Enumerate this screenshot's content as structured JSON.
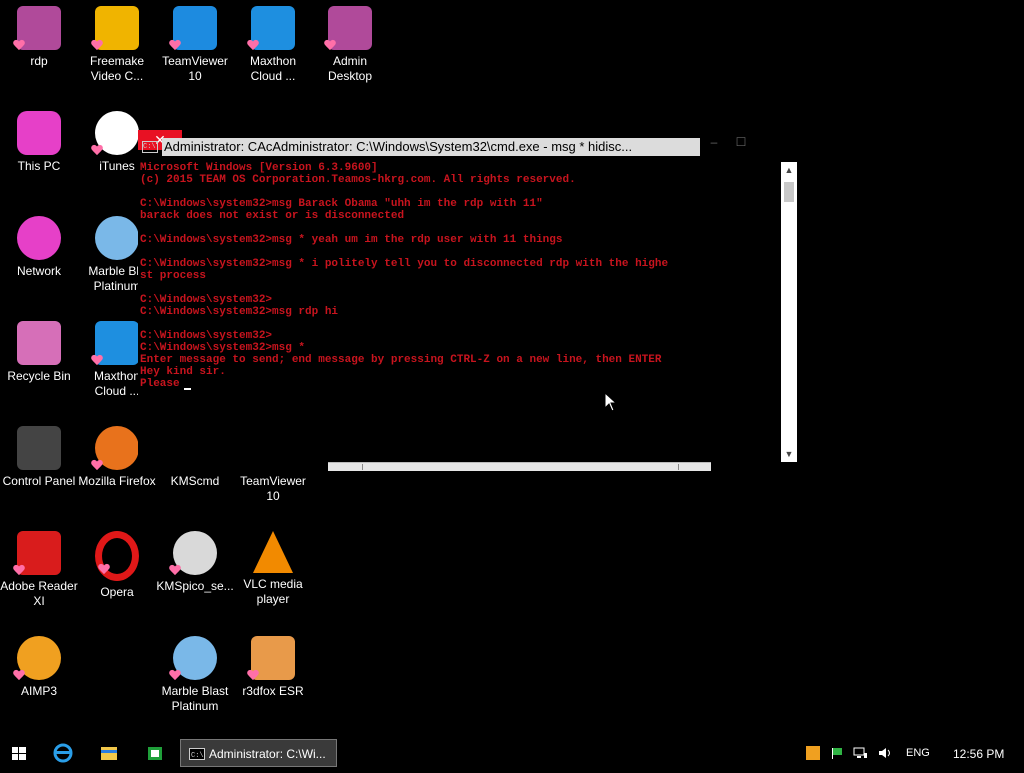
{
  "desktop": {
    "icons": [
      {
        "label": "rdp"
      },
      {
        "label": "Freemake Video C..."
      },
      {
        "label": "TeamViewer 10"
      },
      {
        "label": "Maxthon Cloud ..."
      },
      {
        "label": "Admin Desktop"
      },
      {
        "label": "This PC"
      },
      {
        "label": "iTunes"
      },
      {
        "label": "Network"
      },
      {
        "label": "Marble Bla Platinum"
      },
      {
        "label": "Recycle Bin"
      },
      {
        "label": "Maxthon Cloud ..."
      },
      {
        "label": "Control Panel"
      },
      {
        "label": "Mozilla Firefox"
      },
      {
        "label": "KMScmd"
      },
      {
        "label": "TeamViewer 10"
      },
      {
        "label": "Adobe Reader XI"
      },
      {
        "label": "Opera"
      },
      {
        "label": "KMSpico_se..."
      },
      {
        "label": "VLC media player"
      },
      {
        "label": "AIMP3"
      },
      {
        "label": "Marble Blast Platinum"
      },
      {
        "label": "r3dfox ESR"
      }
    ]
  },
  "cmd_window": {
    "title": "Administrator: CAcAdministrator: C:\\Windows\\System32\\cmd.exe - msg  * hidisc...",
    "minimize_label": "–",
    "maximize_label": "☐",
    "close_label": "✕",
    "lines": [
      "Microsoft Windows [Version 6.3.9600]",
      "(c) 2015 TEAM OS Corporation.Teamos-hkrg.com. All rights reserved.",
      "",
      "C:\\Windows\\system32>msg Barack Obama \"uhh im the rdp with 11\"",
      "barack does not exist or is disconnected",
      "",
      "C:\\Windows\\system32>msg * yeah um im the rdp user with 11 things",
      "",
      "C:\\Windows\\system32>msg * i politely tell you to disconnected rdp with the highe",
      "st process",
      "",
      "C:\\Windows\\system32>",
      "C:\\Windows\\system32>msg rdp hi",
      "",
      "C:\\Windows\\system32>",
      "C:\\Windows\\system32>msg *",
      "Enter message to send; end message by pressing CTRL-Z on a new line, then ENTER",
      "Hey kind sir.",
      "Please"
    ]
  },
  "taskbar": {
    "active_task_label": "Administrator: C:\\Wi...",
    "language": "ENG",
    "clock": "12:56 PM"
  }
}
